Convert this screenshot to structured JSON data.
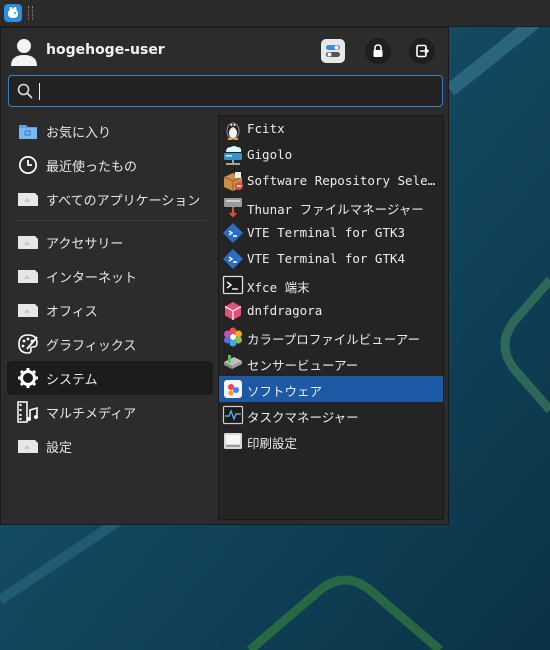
{
  "user": {
    "name": "hogehoge-user"
  },
  "search": {
    "value": "",
    "placeholder": ""
  },
  "categories": [
    {
      "label": "お気に入り",
      "icon": "favorites-folder-icon"
    },
    {
      "label": "最近使ったもの",
      "icon": "clock-icon"
    },
    {
      "label": "すべてのアプリケーション",
      "icon": "generic-app-icon"
    },
    {
      "label": "アクセサリー",
      "icon": "generic-app-icon"
    },
    {
      "label": "インターネット",
      "icon": "generic-app-icon"
    },
    {
      "label": "オフィス",
      "icon": "generic-app-icon"
    },
    {
      "label": "グラフィックス",
      "icon": "palette-icon"
    },
    {
      "label": "システム",
      "icon": "gear-icon",
      "selected": true
    },
    {
      "label": "マルチメディア",
      "icon": "film-music-icon"
    },
    {
      "label": "設定",
      "icon": "generic-app-icon"
    }
  ],
  "apps": [
    {
      "label": "Fcitx",
      "icon": "penguin-icon"
    },
    {
      "label": "Gigolo",
      "icon": "network-drive-icon"
    },
    {
      "label": "Software Repository Selector",
      "icon": "package-icon"
    },
    {
      "label": "Thunar ファイルマネージャー",
      "icon": "file-manager-icon"
    },
    {
      "label": "VTE Terminal for GTK3",
      "icon": "terminal-diamond-icon"
    },
    {
      "label": "VTE Terminal for GTK4",
      "icon": "terminal-diamond-icon"
    },
    {
      "label": "Xfce 端末",
      "icon": "terminal-icon"
    },
    {
      "label": "dnfdragora",
      "icon": "cube-icon"
    },
    {
      "label": "カラープロファイルビューアー",
      "icon": "color-flower-icon"
    },
    {
      "label": "センサービューアー",
      "icon": "sensor-icon"
    },
    {
      "label": "ソフトウェア",
      "icon": "software-icon",
      "selected": true
    },
    {
      "label": "タスクマネージャー",
      "icon": "task-manager-icon"
    },
    {
      "label": "印刷設定",
      "icon": "printer-icon"
    }
  ],
  "colors": {
    "accent": "#1d5aa5",
    "menu_bg": "#2c2c2c",
    "desktop": "#0c3a4f"
  }
}
